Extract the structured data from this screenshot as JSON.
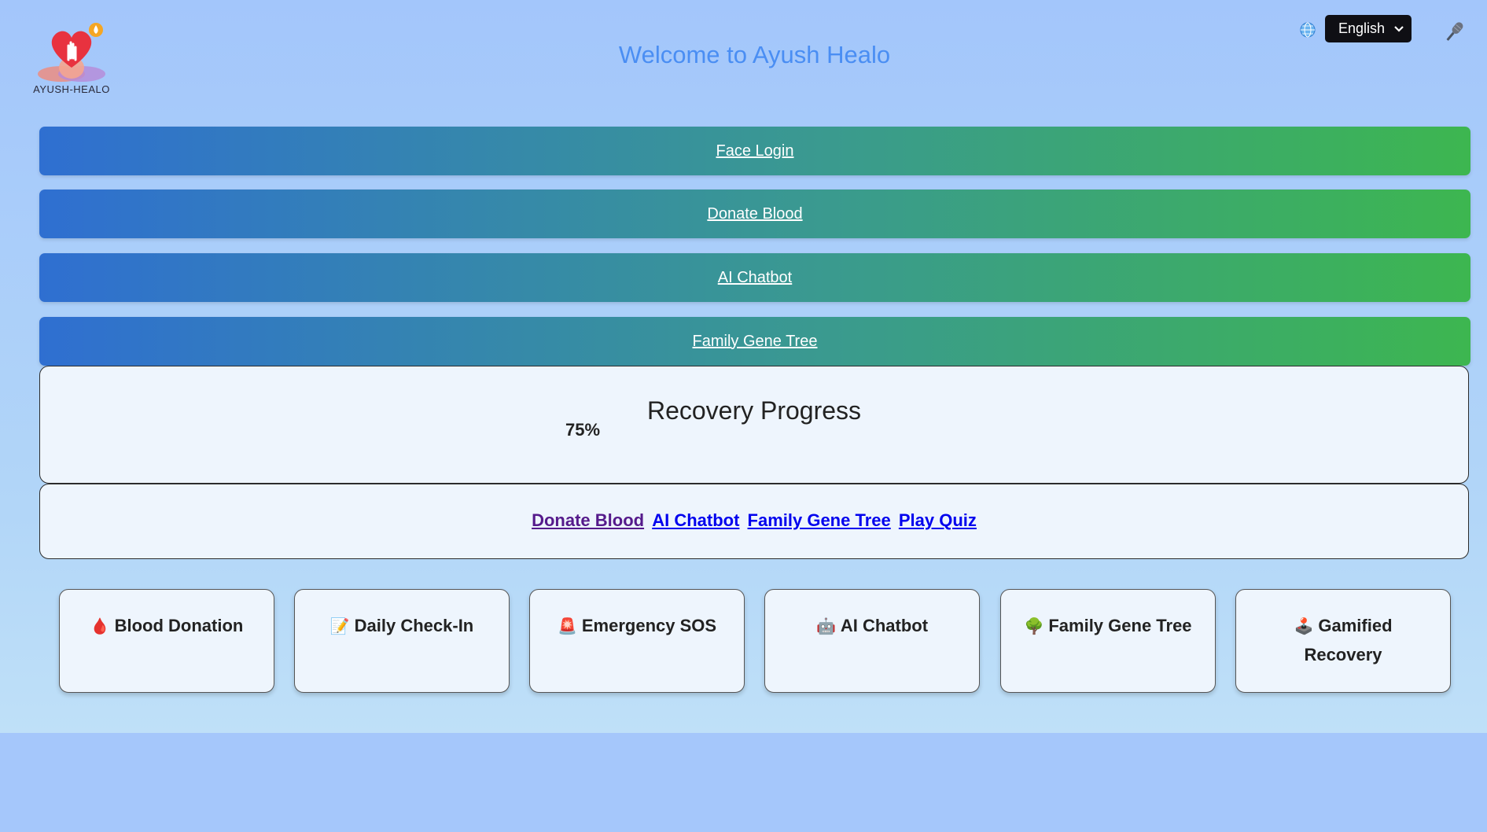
{
  "header": {
    "logo_text": "AYUSH-HEALO",
    "title": "Welcome to Ayush Healo",
    "language": "English",
    "globe_icon": "globe-icon",
    "mic_icon": "microphone-icon"
  },
  "nav_bars": [
    {
      "label": "Face Login"
    },
    {
      "label": "Donate Blood"
    },
    {
      "label": "AI Chatbot"
    },
    {
      "label": "Family Gene Tree"
    }
  ],
  "progress": {
    "title": "Recovery Progress",
    "value_label": "75%",
    "value": 0.75
  },
  "quick_links": [
    {
      "label": "Donate Blood",
      "state": "visited"
    },
    {
      "label": "AI Chatbot",
      "state": "unvisited"
    },
    {
      "label": "Family Gene Tree",
      "state": "unvisited"
    },
    {
      "label": "Play Quiz",
      "state": "unvisited"
    }
  ],
  "tiles": [
    {
      "icon": "🩸",
      "icon_name": "blood-drop-icon",
      "label": "Blood Donation"
    },
    {
      "icon": "📝",
      "icon_name": "memo-icon",
      "label": "Daily Check-In"
    },
    {
      "icon": "🚨",
      "icon_name": "siren-icon",
      "label": "Emergency SOS"
    },
    {
      "icon": "🤖",
      "icon_name": "robot-icon",
      "label": "AI Chatbot"
    },
    {
      "icon": "🌳",
      "icon_name": "tree-icon",
      "label": "Family Gene Tree"
    },
    {
      "icon": "🕹️",
      "icon_name": "joystick-icon",
      "label": "Gamified Recovery"
    }
  ],
  "colors": {
    "title": "#4a8ef3",
    "bar_start": "#2f6fd1",
    "bar_end": "#3db650",
    "card_bg": "#eef5fd"
  }
}
